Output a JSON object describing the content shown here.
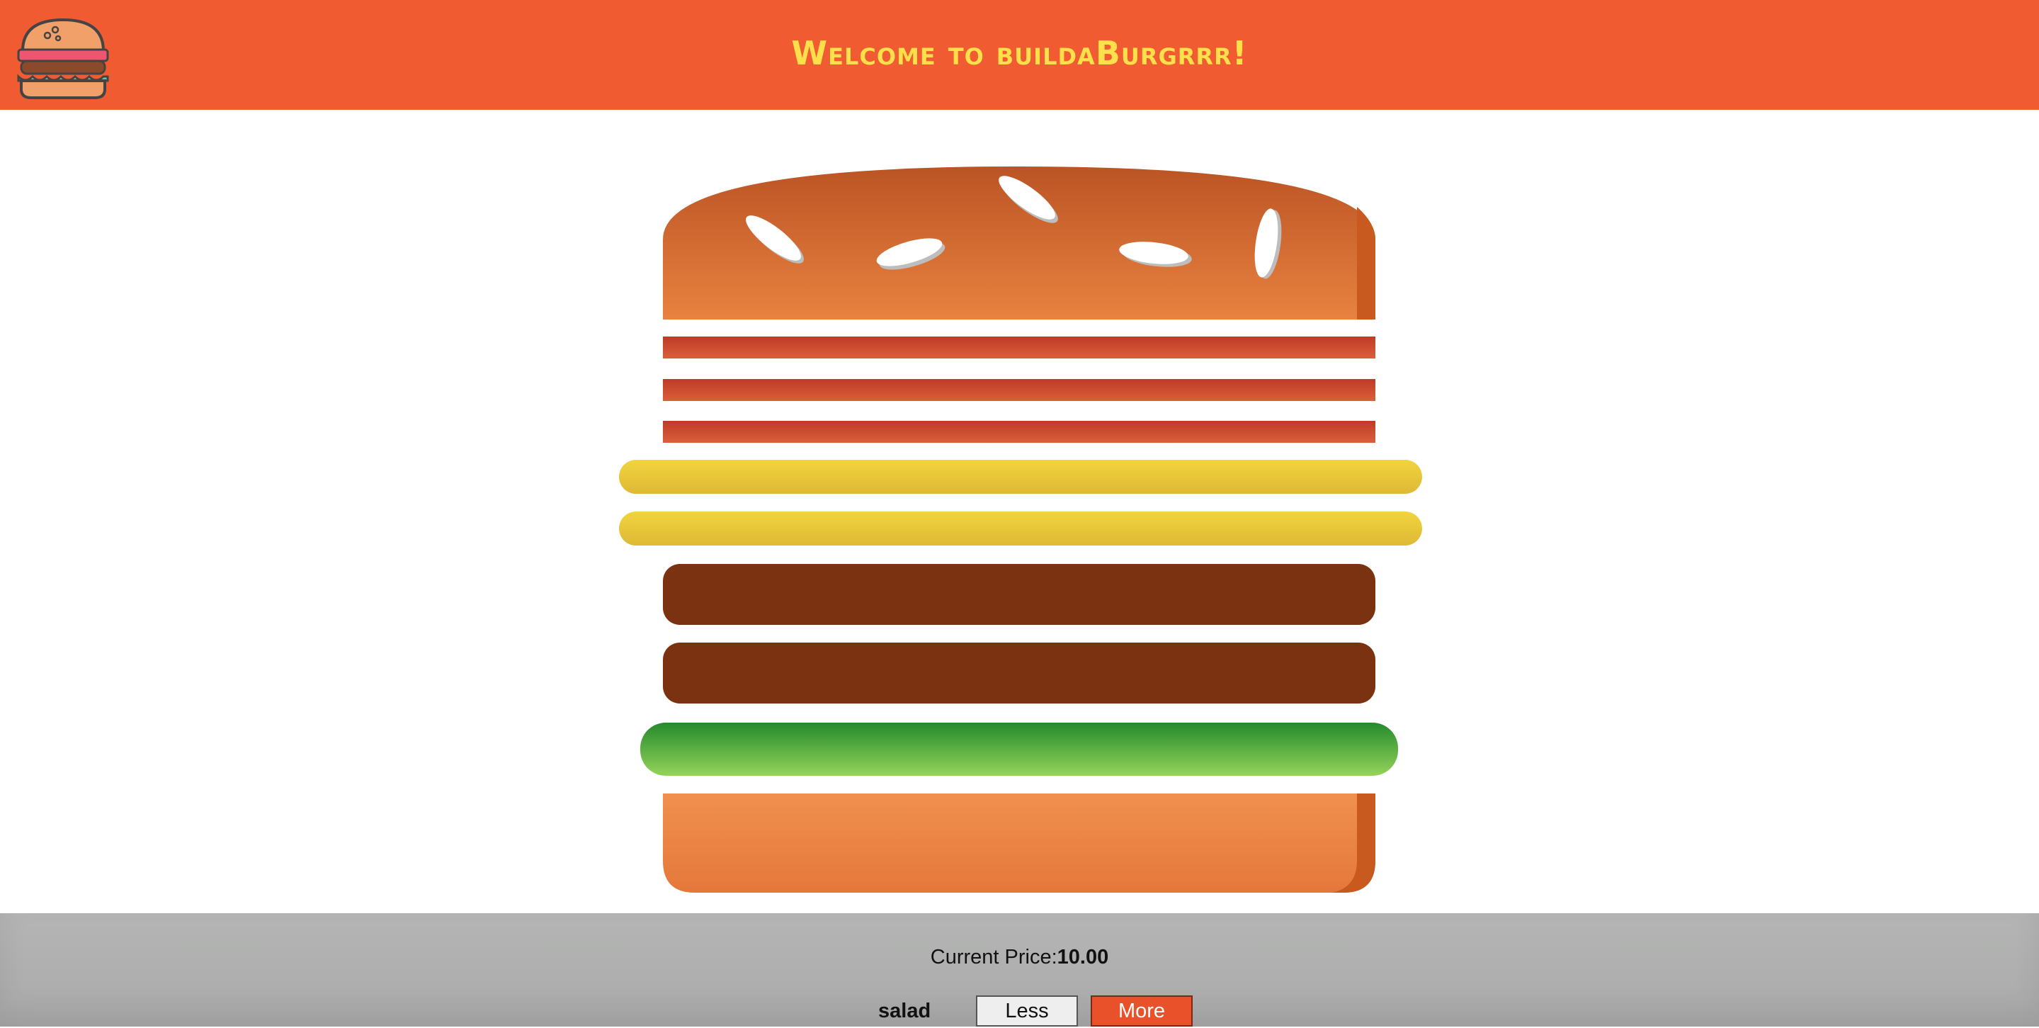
{
  "app": {
    "title": "Welcome to buildaBurgrrr!",
    "logo_icon": "burger-logo-icon"
  },
  "burger": {
    "layers": [
      "bread-top",
      "bacon",
      "bacon",
      "bacon",
      "cheese",
      "cheese",
      "meat",
      "meat",
      "salad",
      "bread-bottom"
    ]
  },
  "controls": {
    "price_label": "Current Price:",
    "price_value": "10.00",
    "ingredient_label": "salad",
    "less_label": "Less",
    "more_label": "More"
  },
  "colors": {
    "header": "#f05b32",
    "title": "#ffdf4a",
    "bread": "#e07a3a",
    "bacon": "#c8412a",
    "cheese": "#e9c53a",
    "meat": "#7b3210",
    "salad": "#4aa63b",
    "controls_bg": "#b4b5b4",
    "more_button": "#e8512a"
  }
}
